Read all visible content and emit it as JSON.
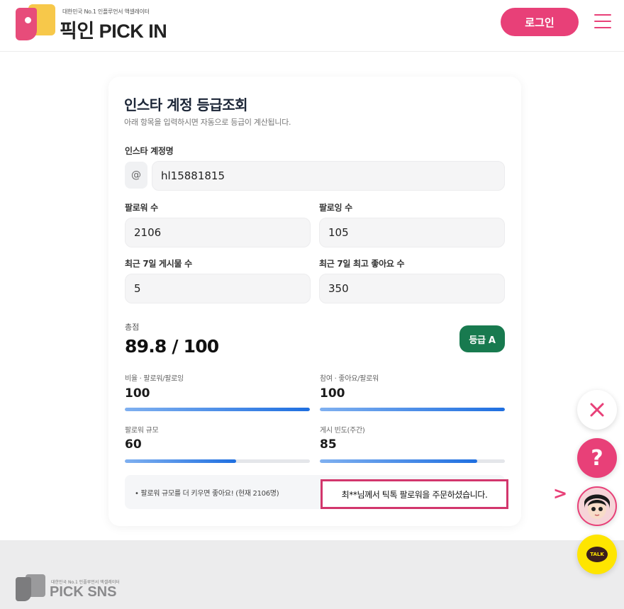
{
  "header": {
    "logo_tagline": "대한민국 No.1 인플루언서 액셀레이터",
    "logo_name": "픽인 PICK IN",
    "login_label": "로그인",
    "menu_icon": "hamburger-icon"
  },
  "card": {
    "title": "인스타 계정 등급조회",
    "subtitle": "아래 항목을 입력하시면 자동으로 등급이 계산됩니다.",
    "account_label": "인스타 계정명",
    "at_symbol": "@",
    "account_value": "hl15881815",
    "followers_label": "팔로워 수",
    "followers_value": "2106",
    "following_label": "팔로잉 수",
    "following_value": "105",
    "posts_label": "최근 7일 게시물 수",
    "posts_value": "5",
    "likes_label": "최근 7일 최고 좋아요 수",
    "likes_value": "350",
    "total_label": "총점",
    "total_value": "89.8 / 100",
    "grade_label": "등급 A",
    "metrics": [
      {
        "label": "비율 · 팔로워/팔로잉",
        "value": "100",
        "fill": 1.0
      },
      {
        "label": "참여 · 좋아요/팔로워",
        "value": "100",
        "fill": 1.0
      },
      {
        "label": "팔로워 규모",
        "value": "60",
        "fill": 0.6
      },
      {
        "label": "게시 빈도(주간)",
        "value": "85",
        "fill": 0.85
      }
    ],
    "tip": "• 팔로워 규모를 더 키우면 좋아요! (현재 2106명)"
  },
  "notice": "최**님께서 틱톡 팔로워을 주문하셨습니다.",
  "footer": {
    "tagline": "대한민국 No.1 인플루언서 액셀레이터",
    "logo_name": "PICK SNS"
  },
  "floating": {
    "close_icon": "close-icon",
    "help_label": "?",
    "avatar": "avatar-icon",
    "talk_label": "TALK",
    "arrow": ">"
  },
  "colors": {
    "brand": "#e84078",
    "grade": "#187a4f",
    "bar": "#1f6fe0",
    "talk": "#fee500"
  }
}
